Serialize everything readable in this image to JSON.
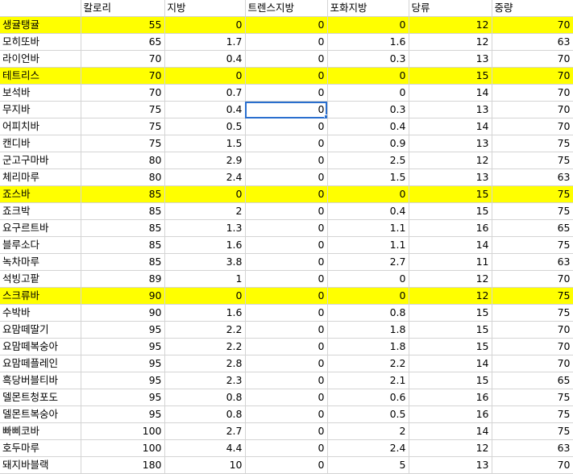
{
  "columns": [
    "",
    "칼로리",
    "지방",
    "트렌스지방",
    "포화지방",
    "당류",
    "중량"
  ],
  "highlight_color": "#ffff00",
  "selection_color": "#2a6fce",
  "selected_cell": {
    "row": 5,
    "col": 3
  },
  "rows": [
    {
      "name": "생귤탱귤",
      "values": [
        "55",
        "0",
        "0",
        "0",
        "12",
        "70"
      ],
      "highlight": true
    },
    {
      "name": "모히또바",
      "values": [
        "65",
        "1.7",
        "0",
        "1.6",
        "12",
        "63"
      ],
      "highlight": false
    },
    {
      "name": "라이언바",
      "values": [
        "70",
        "0.4",
        "0",
        "0.3",
        "13",
        "70"
      ],
      "highlight": false
    },
    {
      "name": "테트리스",
      "values": [
        "70",
        "0",
        "0",
        "0",
        "15",
        "70"
      ],
      "highlight": true
    },
    {
      "name": "보석바",
      "values": [
        "70",
        "0.7",
        "0",
        "0",
        "14",
        "70"
      ],
      "highlight": false
    },
    {
      "name": "무지바",
      "values": [
        "75",
        "0.4",
        "0",
        "0.3",
        "13",
        "70"
      ],
      "highlight": false
    },
    {
      "name": "어피치바",
      "values": [
        "75",
        "0.5",
        "0",
        "0.4",
        "14",
        "70"
      ],
      "highlight": false
    },
    {
      "name": "캔디바",
      "values": [
        "75",
        "1.5",
        "0",
        "0.9",
        "13",
        "75"
      ],
      "highlight": false
    },
    {
      "name": "군고구마바",
      "values": [
        "80",
        "2.9",
        "0",
        "2.5",
        "12",
        "75"
      ],
      "highlight": false
    },
    {
      "name": "체리마루",
      "values": [
        "80",
        "2.4",
        "0",
        "1.5",
        "13",
        "63"
      ],
      "highlight": false
    },
    {
      "name": "죠스바",
      "values": [
        "85",
        "0",
        "0",
        "0",
        "15",
        "75"
      ],
      "highlight": true
    },
    {
      "name": "죠크박",
      "values": [
        "85",
        "2",
        "0",
        "0.4",
        "15",
        "75"
      ],
      "highlight": false
    },
    {
      "name": "요구르트바",
      "values": [
        "85",
        "1.3",
        "0",
        "1.1",
        "16",
        "65"
      ],
      "highlight": false
    },
    {
      "name": "블루소다",
      "values": [
        "85",
        "1.6",
        "0",
        "1.1",
        "14",
        "75"
      ],
      "highlight": false
    },
    {
      "name": "녹차마루",
      "values": [
        "85",
        "3.8",
        "0",
        "2.7",
        "11",
        "63"
      ],
      "highlight": false
    },
    {
      "name": "석빙고팥",
      "values": [
        "89",
        "1",
        "0",
        "0",
        "12",
        "70"
      ],
      "highlight": false
    },
    {
      "name": "스크류바",
      "values": [
        "90",
        "0",
        "0",
        "0",
        "12",
        "75"
      ],
      "highlight": true
    },
    {
      "name": "수박바",
      "values": [
        "90",
        "1.6",
        "0",
        "0.8",
        "15",
        "75"
      ],
      "highlight": false
    },
    {
      "name": "요맘떼딸기",
      "values": [
        "95",
        "2.2",
        "0",
        "1.8",
        "15",
        "70"
      ],
      "highlight": false
    },
    {
      "name": "요맘떼복숭아",
      "values": [
        "95",
        "2.2",
        "0",
        "1.8",
        "15",
        "70"
      ],
      "highlight": false
    },
    {
      "name": "요맘떼플레인",
      "values": [
        "95",
        "2.8",
        "0",
        "2.2",
        "14",
        "70"
      ],
      "highlight": false
    },
    {
      "name": "흑당버블티바",
      "values": [
        "95",
        "2.3",
        "0",
        "2.1",
        "15",
        "65"
      ],
      "highlight": false
    },
    {
      "name": "델몬트청포도",
      "values": [
        "95",
        "0.8",
        "0",
        "0.6",
        "16",
        "75"
      ],
      "highlight": false
    },
    {
      "name": "델몬트복숭아",
      "values": [
        "95",
        "0.8",
        "0",
        "0.5",
        "16",
        "75"
      ],
      "highlight": false
    },
    {
      "name": "빠삐코바",
      "values": [
        "100",
        "2.7",
        "0",
        "2",
        "14",
        "75"
      ],
      "highlight": false
    },
    {
      "name": "호두마루",
      "values": [
        "100",
        "4.4",
        "0",
        "2.4",
        "12",
        "63"
      ],
      "highlight": false
    },
    {
      "name": "돼지바블랙",
      "values": [
        "180",
        "10",
        "0",
        "5",
        "13",
        "70"
      ],
      "highlight": false
    }
  ]
}
